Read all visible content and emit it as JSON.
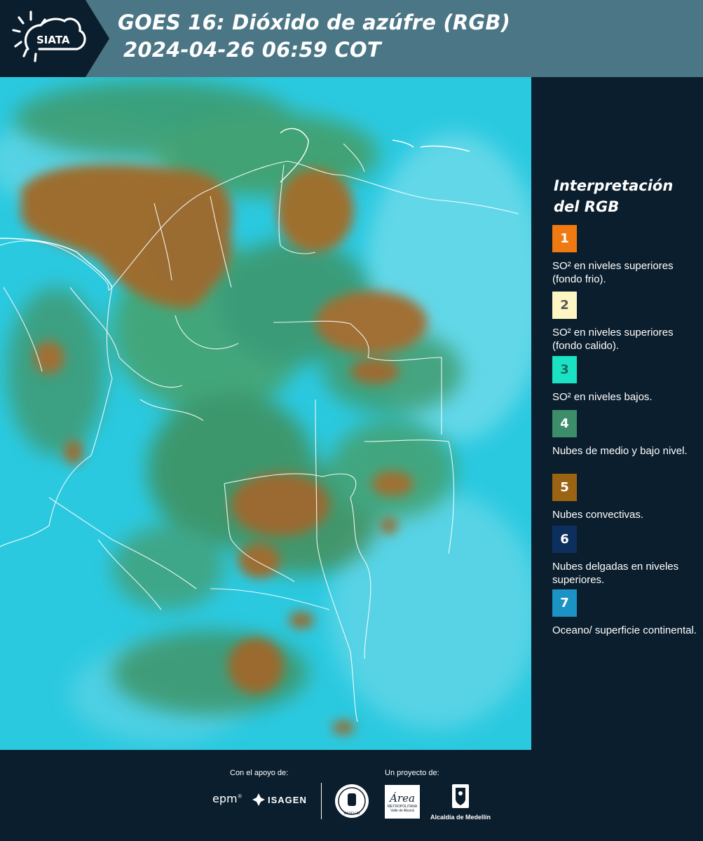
{
  "header": {
    "brand": "SIATA",
    "title_line1": "GOES 16: Dióxido de azúfre (RGB)",
    "title_line2": "2024-04-26 06:59 COT"
  },
  "legend": {
    "title": "Interpretación del RGB",
    "items": [
      {
        "number": "1",
        "color": "#f07a12",
        "text_color": "#ffffff",
        "label": "SO² en niveles superiores (fondo frio)."
      },
      {
        "number": "2",
        "color": "#fdf6c3",
        "text_color": "#555555",
        "label": "SO² en niveles superiores (fondo calido)."
      },
      {
        "number": "3",
        "color": "#19e3c3",
        "text_color": "#1b6a5f",
        "label": "SO² en niveles bajos."
      },
      {
        "number": "4",
        "color": "#3c8d6a",
        "text_color": "#ffffff",
        "label": "Nubes de medio y bajo nivel."
      },
      {
        "number": "5",
        "color": "#9a6412",
        "text_color": "#ffffff",
        "label": "Nubes convectivas."
      },
      {
        "number": "6",
        "color": "#0d2f5e",
        "text_color": "#ffffff",
        "label": "Nubes delgadas en niveles superiores."
      },
      {
        "number": "7",
        "color": "#1b93c5",
        "text_color": "#ffffff",
        "label": "Oceano/ superficie continental."
      }
    ]
  },
  "footer": {
    "support_label": "Con el apoyo de:",
    "project_label": "Un proyecto de:",
    "epm": "epm",
    "isagen": "ISAGEN",
    "metro_name": "Área",
    "metro_sub1": "METROPOLITANA",
    "metro_sub2": "Valle de Aburrá",
    "alcaldia": "Alcaldía de Medellín",
    "uni": "MEDELLÍN"
  },
  "colors": {
    "header_bg": "#4b7685",
    "panel_bg": "#0b1e2d",
    "surface": "#25c6e0",
    "convective": "#9a6a2a",
    "mid_low_cloud": "#3f8a55"
  }
}
